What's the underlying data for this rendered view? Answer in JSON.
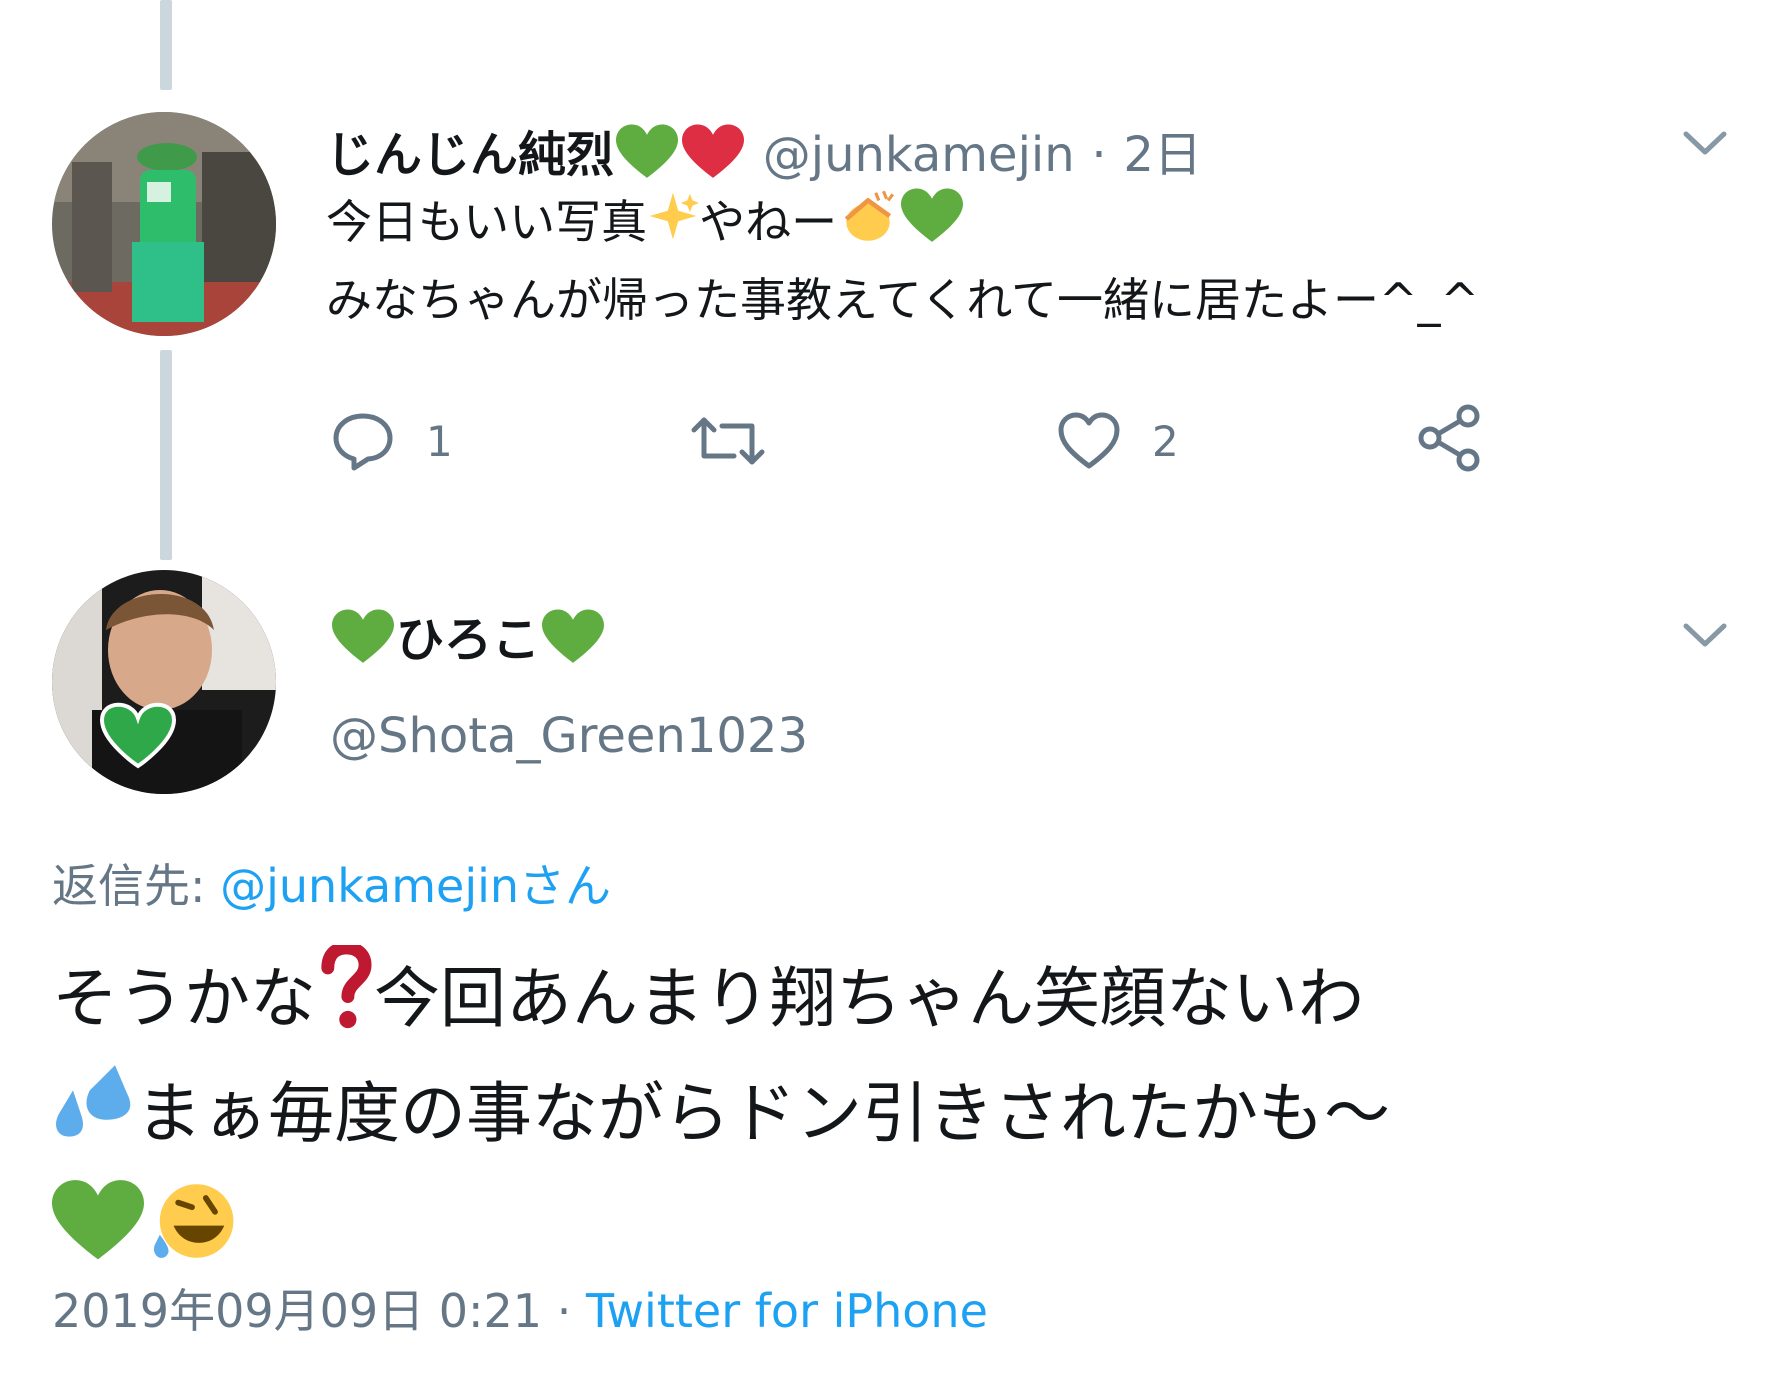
{
  "tweet1": {
    "display_name": "じんじん純烈",
    "handle": "@junkamejin",
    "separator": "·",
    "age": "2日",
    "line1": "今日もいい写真",
    "line1_mid": "やねー",
    "line2": "みなちゃんが帰った事教えてくれて一緒に居たよー^_^",
    "reply_count": "1",
    "like_count": "2",
    "icons": {
      "reply": "reply-icon",
      "retweet": "retweet-icon",
      "like": "heart-icon",
      "share": "share-icon",
      "menu": "chevron-down-icon"
    }
  },
  "tweet2": {
    "display_name": "ひろこ",
    "handle": "@Shota_Green1023",
    "reply_to_label": "返信先:",
    "reply_to_mention": "@junkamejinさん",
    "text_part1": "そうかな",
    "text_part2": "今回あんまり翔ちゃん笑顔ないわ",
    "text_part3": "まぁ毎度の事ながらドン引きされたかも〜",
    "timestamp": "2019年09月09日 0:21",
    "separator": "·",
    "source": "Twitter for iPhone"
  },
  "colors": {
    "text": "#14171a",
    "secondary": "#657786",
    "link": "#1da1f2",
    "thread_line": "#ccd6dd",
    "green_heart": "#5fad41",
    "red_heart": "#dd2e44"
  }
}
